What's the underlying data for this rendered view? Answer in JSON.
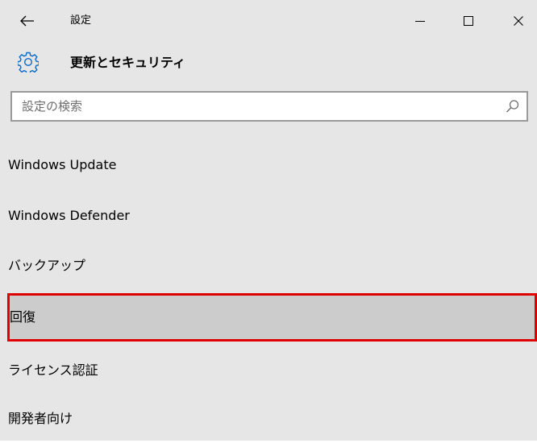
{
  "titlebar": {
    "title": "設定",
    "back_icon": "back-arrow-icon",
    "minimize_icon": "minimize-icon",
    "maximize_icon": "maximize-icon",
    "close_icon": "close-icon"
  },
  "header": {
    "icon": "gear-icon",
    "title": "更新とセキュリティ",
    "accent_color": "#0a6ac9"
  },
  "search": {
    "placeholder": "設定の検索",
    "value": "",
    "icon": "search-icon"
  },
  "nav": {
    "items": [
      {
        "label": "Windows Update",
        "selected": false
      },
      {
        "label": "Windows Defender",
        "selected": false
      },
      {
        "label": "バックアップ",
        "selected": false
      },
      {
        "label": "回復",
        "selected": true
      },
      {
        "label": "ライセンス認証",
        "selected": false
      },
      {
        "label": "開発者向け",
        "selected": false
      }
    ],
    "highlight_color": "#e00000",
    "selected_background": "#cccccc"
  }
}
